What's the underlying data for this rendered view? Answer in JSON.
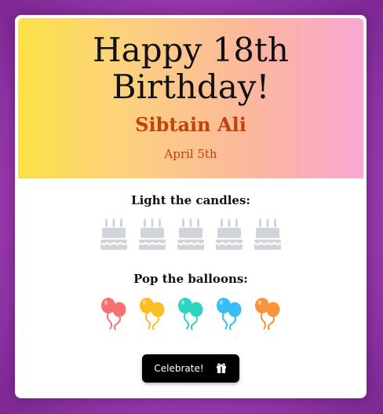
{
  "header": {
    "title": "Happy 18th Birthday!",
    "name": "Sibtain Ali",
    "date": "April 5th"
  },
  "candles": {
    "label": "Light the candles:",
    "items": [
      {
        "icon": "birthday-cake-icon",
        "lit": false
      },
      {
        "icon": "birthday-cake-icon",
        "lit": false
      },
      {
        "icon": "birthday-cake-icon",
        "lit": false
      },
      {
        "icon": "birthday-cake-icon",
        "lit": false
      },
      {
        "icon": "birthday-cake-icon",
        "lit": false
      }
    ],
    "color": "#d1d5db"
  },
  "balloons": {
    "label": "Pop the balloons:",
    "items": [
      {
        "icon": "balloons-icon",
        "color": "#f87171"
      },
      {
        "icon": "balloons-icon",
        "color": "#fbbf24"
      },
      {
        "icon": "balloons-icon",
        "color": "#2dd4bf"
      },
      {
        "icon": "balloons-icon",
        "color": "#38bdf8"
      },
      {
        "icon": "balloons-icon",
        "color": "#fb923c"
      }
    ]
  },
  "action": {
    "label": "Celebrate!",
    "icon": "gift-icon"
  },
  "colors": {
    "accent": "#c2410c",
    "gradient_start": "#fde047",
    "gradient_end": "#f9a8d4",
    "background": "#a23fb6"
  }
}
